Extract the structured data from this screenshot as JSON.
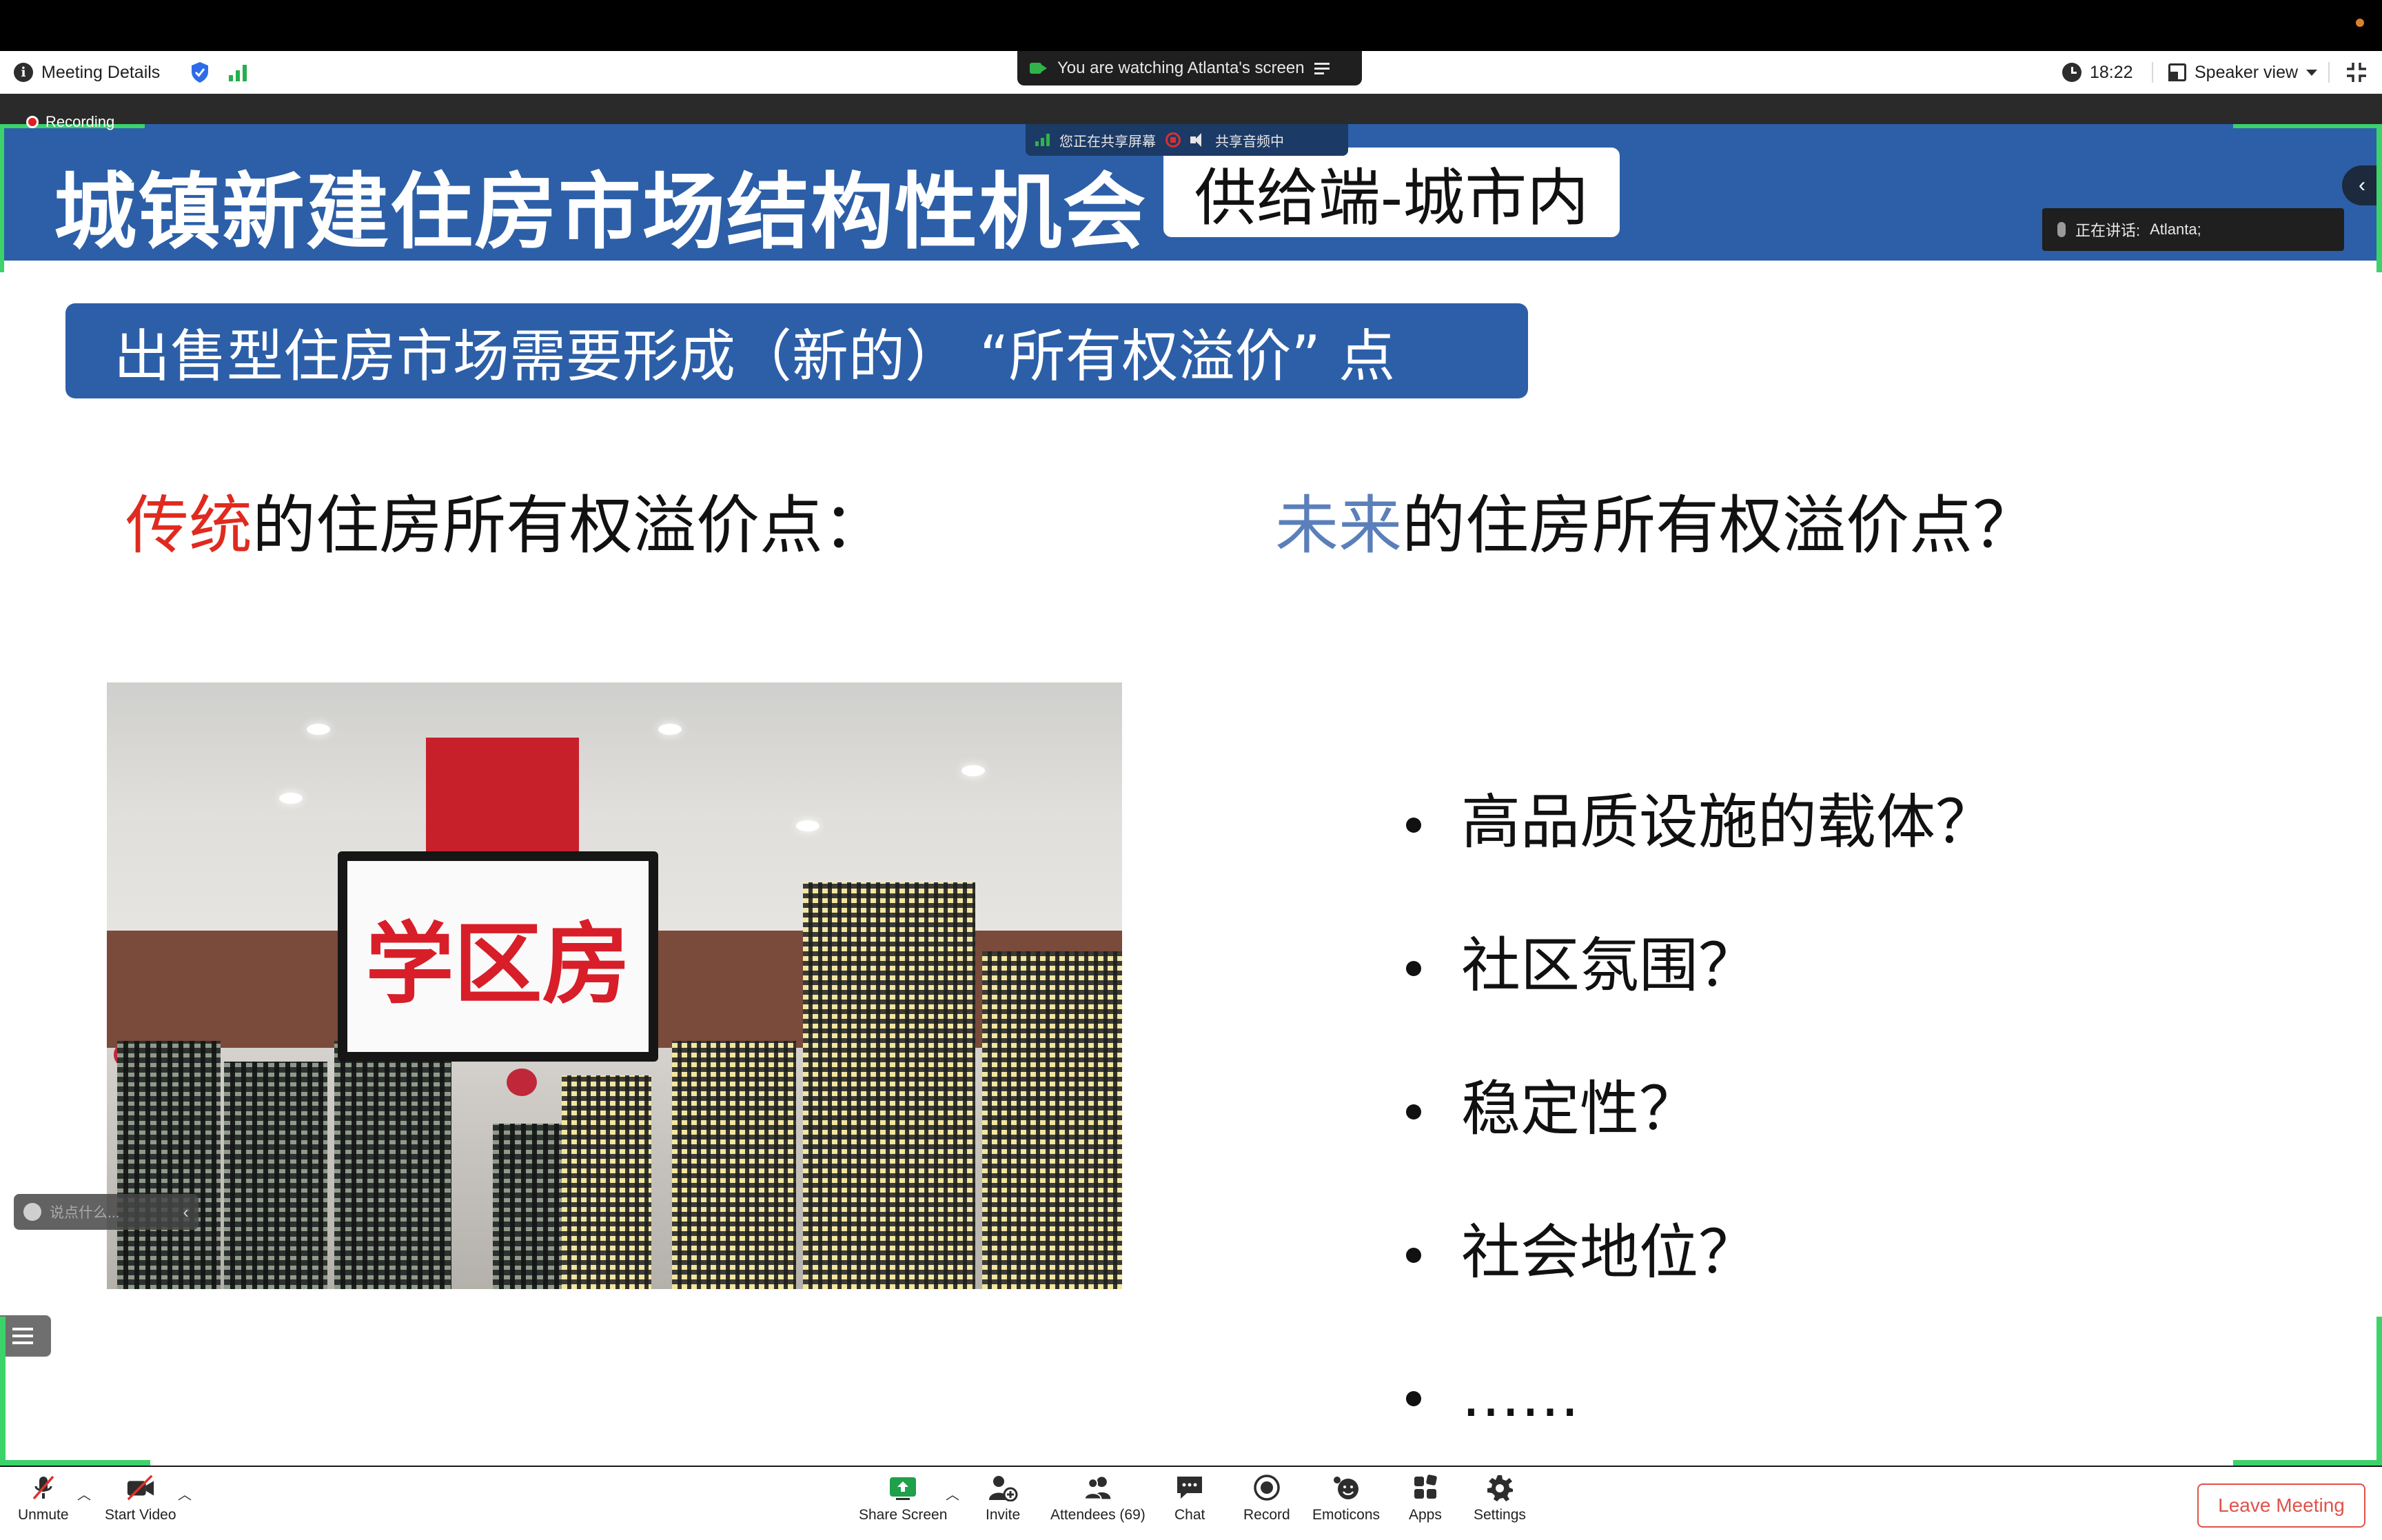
{
  "top_bar": {
    "meeting_details": "Meeting Details",
    "watching_banner": "You are watching Atlanta's screen",
    "time": "18:22",
    "view_mode": "Speaker view"
  },
  "recording": {
    "label": "Recording"
  },
  "share_overlay": {
    "sharing_label": "您正在共享屏幕",
    "audio_label": "共享音频中",
    "talking_label": "正在讲话:",
    "talking_name": "Atlanta;",
    "chat_placeholder": "说点什么..."
  },
  "slide": {
    "title": "城镇新建住房市场结构性机会",
    "title_tag": "供给端-城市内",
    "subtitle": "出售型住房市场需要形成（新的） “所有权溢价” 点",
    "left_heading_highlight": "传统",
    "left_heading_rest": "的住房所有权溢价点：",
    "right_heading_highlight": "未来",
    "right_heading_rest": "的住房所有权溢价点？",
    "photo_sign": "学区房",
    "bullets": [
      "高品质设施的载体？",
      "社区氛围？",
      "稳定性？",
      "社会地位？",
      "……"
    ]
  },
  "toolbar": {
    "unmute": "Unmute",
    "start_video": "Start Video",
    "share_screen": "Share Screen",
    "invite": "Invite",
    "attendees": "Attendees (69)",
    "chat": "Chat",
    "record": "Record",
    "emoticons": "Emoticons",
    "apps": "Apps",
    "settings": "Settings",
    "leave": "Leave Meeting"
  },
  "colors": {
    "slide_blue": "#2c5fa8",
    "highlight_red": "#e02a1f",
    "highlight_blue": "#5b7fba",
    "share_green": "#3bd36a",
    "leave_red": "#e0524a"
  }
}
